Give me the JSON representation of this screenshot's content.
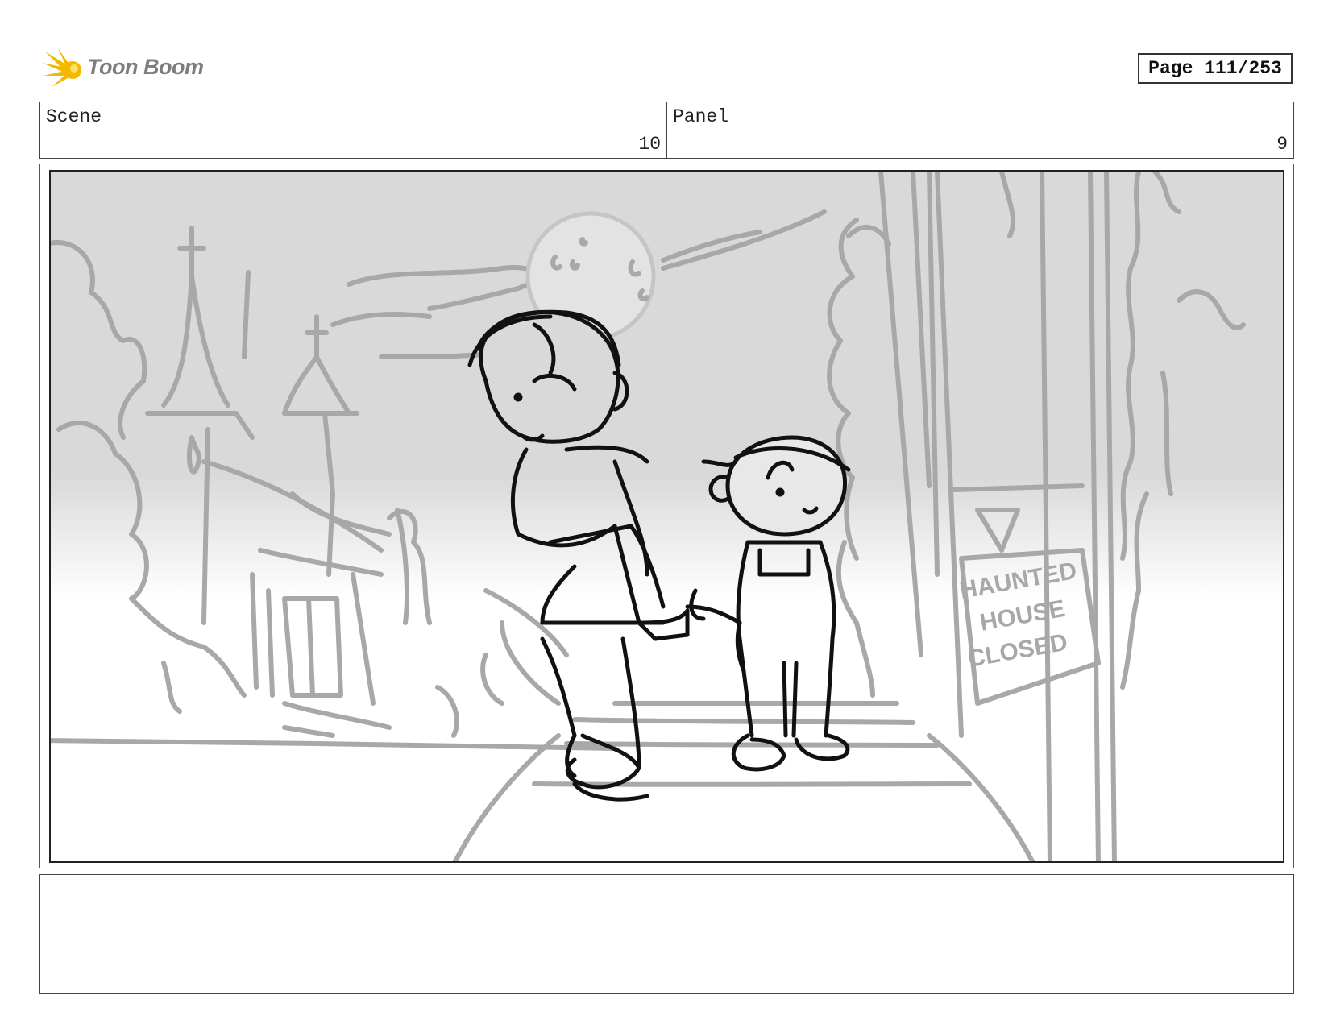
{
  "header": {
    "logo_text": "Toon Boom",
    "logo_color": "#f5b800",
    "page_label": "Page 111/253"
  },
  "info": {
    "scene_label": "Scene",
    "scene_value": "10",
    "panel_label": "Panel",
    "panel_value": "9"
  },
  "sketch": {
    "sign_text": [
      "HAUNTED",
      "HOUSE",
      "CLOSED"
    ],
    "line_color": "#111111",
    "background_line_color": "#a8a8a8"
  },
  "notes": {
    "text": ""
  }
}
